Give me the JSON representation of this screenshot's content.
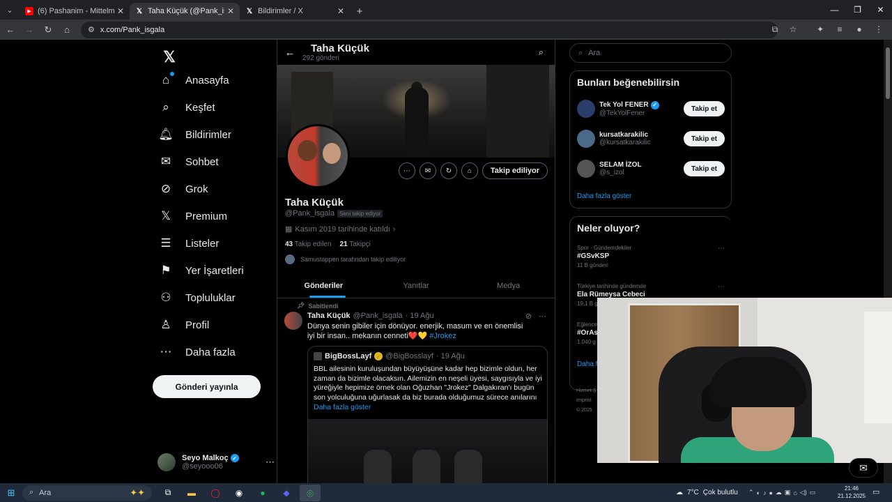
{
  "browser": {
    "tabs": [
      {
        "title": "(6) Pashanim - Mittelmeer - You",
        "favicon": "youtube-icon",
        "color": "#ff0000"
      },
      {
        "title": "Taha Küçük (@Pank_isgala) / X",
        "favicon": "x-icon",
        "color": "#ffffff"
      },
      {
        "title": "Bildirimler / X",
        "favicon": "x-icon",
        "color": "#ffffff"
      }
    ],
    "url": "x.com/Pank_isgala"
  },
  "nav": {
    "items": [
      {
        "label": "Anasayfa",
        "icon": "home-icon"
      },
      {
        "label": "Keşfet",
        "icon": "search-icon"
      },
      {
        "label": "Bildirimler",
        "icon": "bell-icon"
      },
      {
        "label": "Sohbet",
        "icon": "mail-icon"
      },
      {
        "label": "Grok",
        "icon": "grok-icon"
      },
      {
        "label": "Premium",
        "icon": "x-icon"
      },
      {
        "label": "Listeler",
        "icon": "list-icon"
      },
      {
        "label": "Yer İşaretleri",
        "icon": "bookmark-icon"
      },
      {
        "label": "Topluluklar",
        "icon": "community-icon"
      },
      {
        "label": "Profil",
        "icon": "person-icon"
      },
      {
        "label": "Daha fazla",
        "icon": "more-circle-icon"
      }
    ],
    "post_button": "Gönderi yayınla",
    "account": {
      "name": "Seyo Malkoç",
      "handle": "@seyooo06"
    }
  },
  "profile": {
    "header_name": "Taha Küçük",
    "post_count": "292 gönderi",
    "name": "Taha Küçük",
    "handle": "@Pank_isgala",
    "follows_you": "Seni takip ediyor",
    "joined": "Kasım 2019 tarihinde katıldı",
    "following_count": "43",
    "following_label": "Takip edilen",
    "followers_count": "21",
    "followers_label": "Takipçi",
    "followed_by": "Samustappen tarafından takip ediliyor",
    "follow_button": "Takip ediliyor"
  },
  "tabs": [
    "Gönderiler",
    "Yanıtlar",
    "Medya"
  ],
  "tweet": {
    "pinned": "Sabitlendi",
    "author": "Taha Küçük",
    "handle": "@Pank_isgala",
    "date": "· 19 Ağu",
    "text": "Dünya senin gibiler için dönüyor. enerjik, masum ve en önemlisi iyi bir insan.. mekanın cenneti",
    "emoji": "❤️💛",
    "hashtag": "#Jrokez",
    "quote": {
      "author": "BigBossLayf",
      "handle": "@BigBosslayf",
      "date": "· 19 Ağu",
      "text": "BBL ailesinin kuruluşundan büyüyüşüne kadar hep bizimle oldun, her zaman da bizimle olacaksın. Ailemizin en neşeli üyesi, saygısıyla ve iyi yüreğiyle hepimize örnek olan Oğuzhan \"Jrokez\" Dalgakıran'ı bugün son yolculuğuna uğurlasak da biz burada olduğumuz sürece anılarını",
      "more": "Daha fazla göster"
    }
  },
  "right": {
    "search_placeholder": "Ara",
    "suggest_title": "Bunları beğenebilirsin",
    "suggestions": [
      {
        "name": "Tek Yol FENER",
        "handle": "@TekYolFener",
        "button": "Takip et"
      },
      {
        "name": "kursatkarakilic",
        "handle": "@kursatkarakilic",
        "button": "Takip et"
      },
      {
        "name": "SELAM İZOL",
        "handle": "@s_izol",
        "button": "Takip et"
      }
    ],
    "show_more": "Daha fazla göster",
    "trends_title": "Neler oluyor?",
    "trends": [
      {
        "context": "Spor · Gündemdekiler",
        "title": "#GSvKSP",
        "count": "11 B gönderi"
      },
      {
        "context": "Türkiye tarihinde gündemde",
        "title": "Ela Rümeysa Cebeci",
        "count": "19,1 B g"
      },
      {
        "context": "Eğlence",
        "title": "#OrAs",
        "count": "1.040 g"
      }
    ],
    "trends_more": "Daha f",
    "footer": [
      "Hizmet Ş",
      "Imprint",
      "© 2025"
    ]
  },
  "taskbar": {
    "search": "Ara",
    "weather": "7°C",
    "weather_desc": "Çok bulutlu",
    "time": "21:46",
    "date": "21.12.2025"
  }
}
